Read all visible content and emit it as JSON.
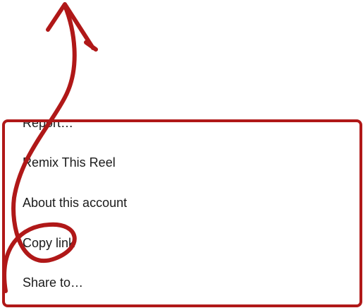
{
  "menu": {
    "items": [
      {
        "label": "Report…"
      },
      {
        "label": "Remix This Reel"
      },
      {
        "label": "About this account"
      },
      {
        "label": "Copy link"
      },
      {
        "label": "Share to…"
      }
    ]
  },
  "annotation": {
    "color": "#b01818",
    "shapes": [
      "arrow-icon",
      "circle-highlight",
      "highlight-box"
    ]
  }
}
